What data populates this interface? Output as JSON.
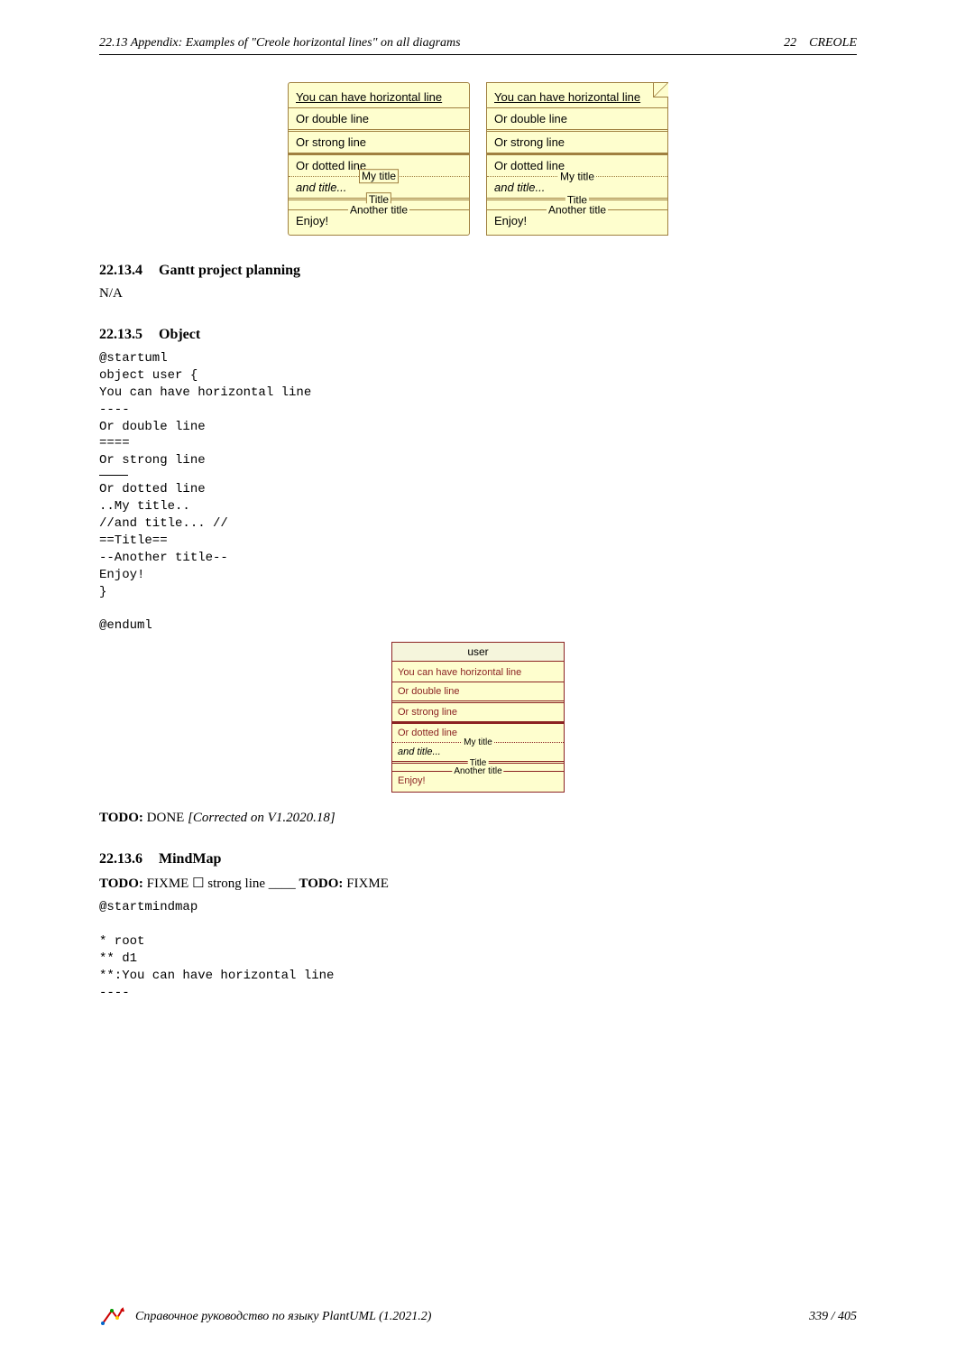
{
  "header": {
    "left": "22.13    Appendix: Examples of \"Creole horizontal lines\" on all diagrams",
    "right_num": "22",
    "right_label": "CREOLE"
  },
  "box": {
    "line1": "You can have horizontal line",
    "line2": "Or double line",
    "line3": "Or strong line",
    "line4": "Or dotted line",
    "mytitle": "My title",
    "andtitle": "and title...",
    "titleword": "Title",
    "anothertitle": "Another title",
    "enjoy": "Enjoy!"
  },
  "sections": {
    "s4_num": "22.13.4",
    "s4_title": "Gantt project planning",
    "s4_body": "N/A",
    "s5_num": "22.13.5",
    "s5_title": "Object",
    "s6_num": "22.13.6",
    "s6_title": "MindMap"
  },
  "code_object": "@startuml\nobject user {\nYou can have horizontal line\n----\nOr double line\n====\nOr strong line\n\nOr dotted line\n..My title..\n//and title... //\n==Title==\n--Another title--\nEnjoy!\n}\n\n@enduml",
  "obj": {
    "title": "user"
  },
  "todo": {
    "label": "TODO:",
    "done": "DONE",
    "corrected": "[Corrected on V1.2020.18]",
    "fixme": "FIXME",
    "strong_line": "strong line",
    "underscores": "____"
  },
  "code_mindmap": "@startmindmap\n\n* root\n** d1\n**:You can have horizontal line\n----",
  "footer": {
    "text": "Справочное руководство по языку PlantUML (1.2021.2)",
    "page": "339 / 405"
  }
}
